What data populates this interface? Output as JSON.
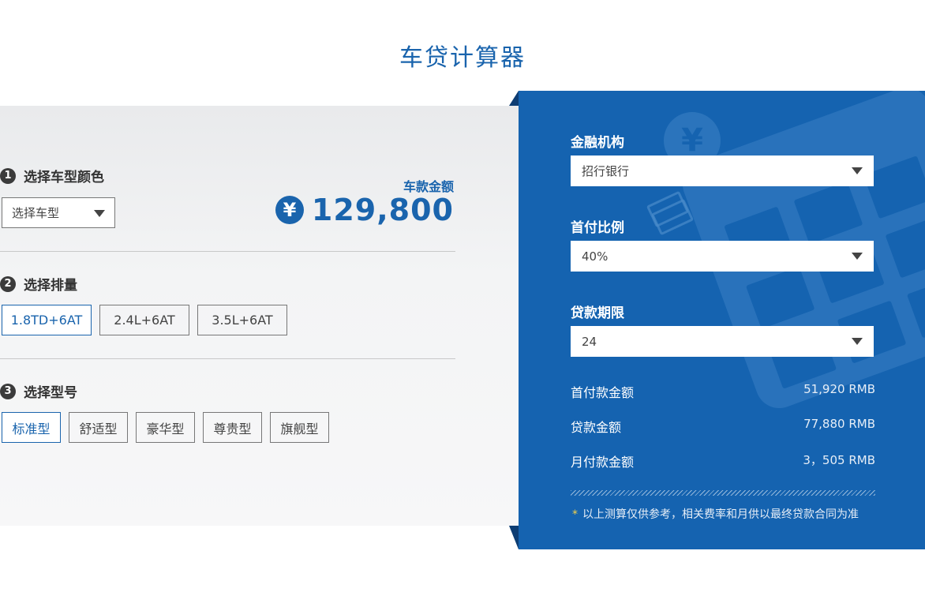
{
  "title": "车贷计算器",
  "left": {
    "step1": {
      "num": "1",
      "label": "选择车型颜色"
    },
    "model_select": {
      "value": "选择车型"
    },
    "price": {
      "label": "车款金额",
      "currency": "¥",
      "value": "129,800"
    },
    "step2": {
      "num": "2",
      "label": "选择排量"
    },
    "displacements": [
      {
        "label": "1.8TD+6AT",
        "active": true
      },
      {
        "label": "2.4L+6AT",
        "active": false
      },
      {
        "label": "3.5L+6AT",
        "active": false
      }
    ],
    "step3": {
      "num": "3",
      "label": "选择型号"
    },
    "trims": [
      {
        "label": "标准型",
        "active": true
      },
      {
        "label": "舒适型",
        "active": false
      },
      {
        "label": "豪华型",
        "active": false
      },
      {
        "label": "尊贵型",
        "active": false
      },
      {
        "label": "旗舰型",
        "active": false
      }
    ]
  },
  "right": {
    "institution": {
      "label": "金融机构",
      "value": "招行银行"
    },
    "down_ratio": {
      "label": "首付比例",
      "value": "40%"
    },
    "term": {
      "label": "贷款期限",
      "value": "24"
    },
    "results": [
      {
        "label": "首付款金额",
        "value": "51,920 RMB"
      },
      {
        "label": "贷款金额",
        "value": "77,880 RMB"
      },
      {
        "label": "月付款金额",
        "value": "3，505 RMB"
      }
    ],
    "note_star": "*",
    "note": "以上测算仅供参考，相关费率和月供以最终贷款合同为准",
    "coin_symbol": "¥"
  },
  "colors": {
    "brand_blue": "#1a64ad",
    "panel_blue": "#1563b0",
    "accent_yellow": "#f3d24a"
  },
  "icons": [
    "chevron-down-icon",
    "yen-icon",
    "calculator-icon",
    "cash-icon"
  ]
}
